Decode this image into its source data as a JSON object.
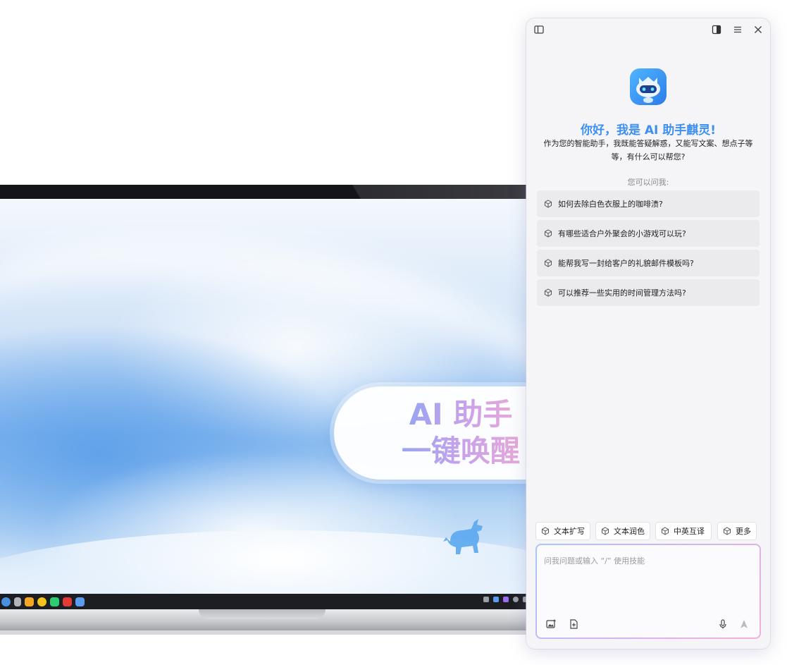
{
  "callout": {
    "line1": "AI 助手",
    "line2": "一键唤醒"
  },
  "assistant": {
    "window_icons": [
      "sidebar-toggle-icon",
      "layout-icon",
      "menu-icon",
      "close-icon"
    ],
    "greeting": "你好，我是 AI 助手麒灵!",
    "intro": "作为您的智能助手，我既能答疑解惑，又能写文案、想点子等等，有什么可以帮您?",
    "ask_label": "您可以问我:",
    "suggestions": [
      "如何去除白色衣服上的咖啡渍?",
      "有哪些适合户外聚会的小游戏可以玩?",
      "能帮我写一封给客户的礼貌邮件模板吗?",
      "可以推荐一些实用的时间管理方法吗?"
    ],
    "skills": [
      "文本扩写",
      "文本润色",
      "中英互译",
      "更多"
    ],
    "input_placeholder": "问我问题或输入 “/” 使用技能",
    "input_icons": [
      "image-upload-icon",
      "file-upload-icon",
      "microphone-icon",
      "send-icon"
    ]
  },
  "colors": {
    "accent": "#3d8ff0",
    "callout_gradient": [
      "#9aa4f0",
      "#c6a2ec",
      "#e6a8d8"
    ],
    "composer_border": [
      "#a8c6f7",
      "#d2b4f0",
      "#f0b2dd"
    ]
  }
}
